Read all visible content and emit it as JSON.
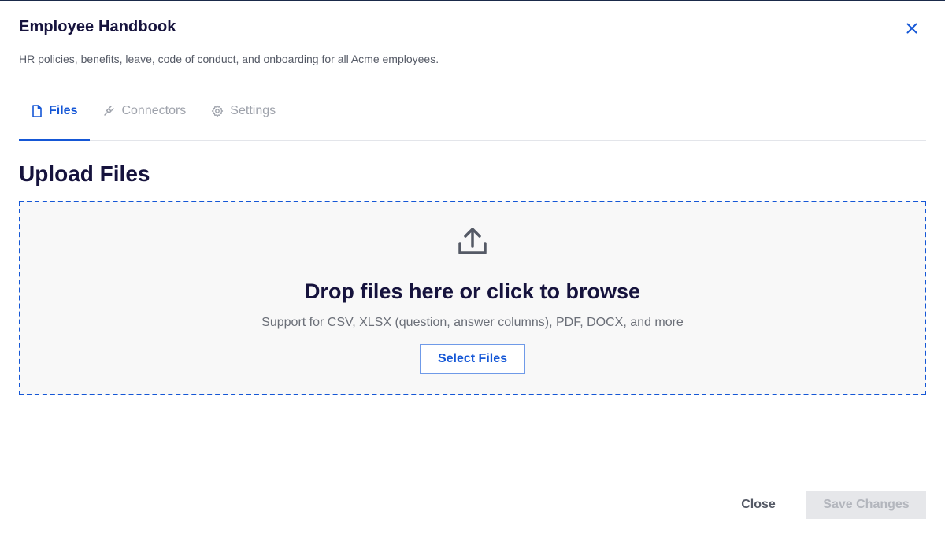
{
  "dialog": {
    "title": "Employee Handbook",
    "subtitle": "HR policies, benefits, leave, code of conduct, and onboarding for all Acme employees."
  },
  "tabs": [
    {
      "label": "Files",
      "icon": "file-icon",
      "active": true
    },
    {
      "label": "Connectors",
      "icon": "plug-icon",
      "active": false
    },
    {
      "label": "Settings",
      "icon": "gear-icon",
      "active": false
    }
  ],
  "upload": {
    "section_title": "Upload Files",
    "drop_title": "Drop files here or click to browse",
    "drop_subtitle": "Support for CSV, XLSX (question, answer columns), PDF, DOCX, and more",
    "select_button": "Select Files",
    "icon": "upload-icon"
  },
  "footer": {
    "close_label": "Close",
    "save_label": "Save Changes",
    "save_disabled": true
  },
  "colors": {
    "accent": "#1557d6",
    "heading": "#16133d",
    "muted": "#9ea2ab",
    "dropzone_bg": "#f8f8f8"
  }
}
